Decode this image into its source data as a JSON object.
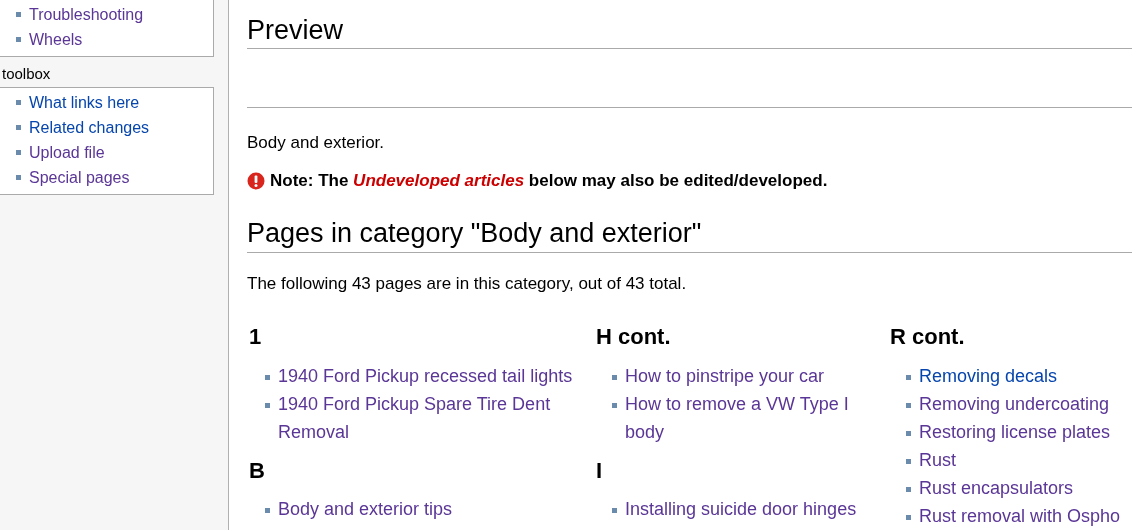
{
  "sidebar": {
    "portlets": [
      {
        "items": [
          {
            "label": "Troubleshooting",
            "visited": true
          },
          {
            "label": "Wheels",
            "visited": true
          }
        ]
      },
      {
        "heading": "toolbox",
        "items": [
          {
            "label": "What links here",
            "visited": false
          },
          {
            "label": "Related changes",
            "visited": false
          },
          {
            "label": "Upload file",
            "visited": true
          },
          {
            "label": "Special pages",
            "visited": true
          }
        ]
      }
    ]
  },
  "preview_heading": "Preview",
  "intro": "Body and exterior.",
  "note": {
    "prefix": "Note: The ",
    "link": "Undeveloped articles",
    "suffix": " below may also be edited/developed."
  },
  "category_heading": "Pages in category \"Body and exterior\"",
  "count_text": "The following 43 pages are in this category, out of 43 total.",
  "columns": [
    {
      "groups": [
        {
          "heading": "1",
          "items": [
            {
              "label": "1940 Ford Pickup recessed tail lights",
              "visited": true
            },
            {
              "label": "1940 Ford Pickup Spare Tire Dent Removal",
              "visited": true
            }
          ]
        },
        {
          "heading": "B",
          "items": [
            {
              "label": "Body and exterior tips",
              "visited": true
            }
          ]
        }
      ]
    },
    {
      "groups": [
        {
          "heading": "H cont.",
          "items": [
            {
              "label": "How to pinstripe your car",
              "visited": true
            },
            {
              "label": "How to remove a VW Type I body",
              "visited": true
            }
          ]
        },
        {
          "heading": "I",
          "items": [
            {
              "label": "Installing suicide door hinges",
              "visited": true
            }
          ]
        }
      ]
    },
    {
      "groups": [
        {
          "heading": "R cont.",
          "items": [
            {
              "label": "Removing decals",
              "visited": false
            },
            {
              "label": "Removing undercoating",
              "visited": true
            },
            {
              "label": "Restoring license plates",
              "visited": true
            },
            {
              "label": "Rust",
              "visited": true
            },
            {
              "label": "Rust encapsulators",
              "visited": true
            },
            {
              "label": "Rust removal with Ospho",
              "visited": true
            }
          ]
        }
      ]
    }
  ]
}
